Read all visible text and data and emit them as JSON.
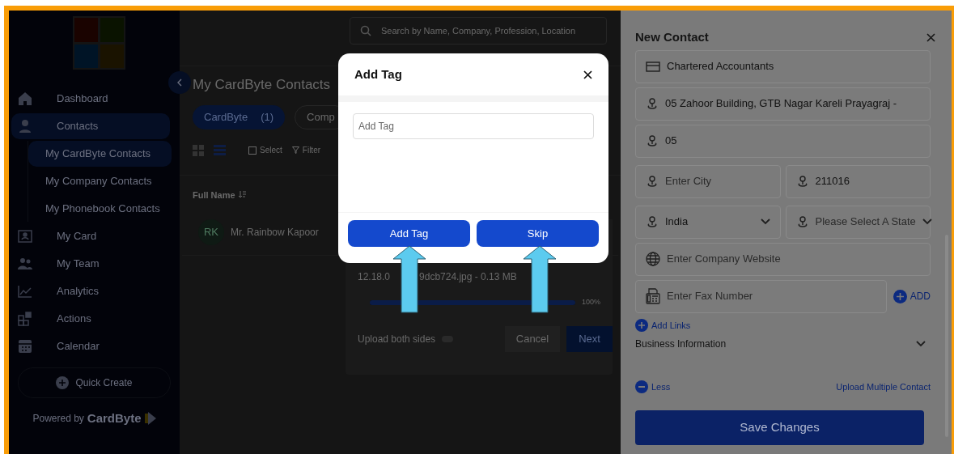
{
  "sidebar": {
    "items": [
      {
        "label": "Dashboard",
        "selected": false
      },
      {
        "label": "Contacts",
        "selected": true,
        "children": [
          {
            "label": "My CardByte Contacts",
            "selected": true
          },
          {
            "label": "My Company Contacts",
            "selected": false
          },
          {
            "label": "My Phonebook Contacts",
            "selected": false
          }
        ]
      },
      {
        "label": "My Card",
        "selected": false
      },
      {
        "label": "My Team",
        "selected": false
      },
      {
        "label": "Analytics",
        "selected": false
      },
      {
        "label": "Actions",
        "selected": false
      },
      {
        "label": "Calendar",
        "selected": false
      }
    ],
    "quick_create": "Quick Create",
    "powered_by": "Powered by",
    "brand": "CardByte"
  },
  "main": {
    "search": {
      "placeholder": "Search by Name, Company, Profession, Location"
    },
    "title": "My CardByte Contacts",
    "tabs": [
      {
        "label": "CardByte",
        "count": "(1)",
        "selected": true
      },
      {
        "label": "Comp",
        "selected": false
      }
    ],
    "toolbar": {
      "select": {
        "label": "Select",
        "checked": false
      },
      "filter": "Filter"
    },
    "table": {
      "columns": [
        "Full Name"
      ],
      "rows": [
        {
          "initials": "RK",
          "name": "Mr. Rainbow Kapoor"
        }
      ]
    },
    "upload": {
      "file_start": "12.18.0",
      "file_end": "9dcb724.jpg - 0.13 MB",
      "level": 1,
      "percent": "100%",
      "both_sides": {
        "label": "Upload both sides",
        "on": false
      },
      "buttons": [
        "Cancel",
        "Next"
      ]
    }
  },
  "panel": {
    "title": "New Contact",
    "fields": [
      {
        "kind": "text",
        "value": "Chartered Accountants"
      },
      {
        "kind": "text",
        "value": "05 Zahoor Building, GTB Nagar Kareli Prayagraj -"
      },
      {
        "kind": "text",
        "value": "05"
      },
      {
        "kind": "pair",
        "items": [
          {
            "kind": "text",
            "placeholder": "Enter City"
          },
          {
            "kind": "text",
            "value": "211016"
          }
        ]
      },
      {
        "kind": "pair",
        "items": [
          {
            "kind": "select",
            "value": "India"
          },
          {
            "kind": "select",
            "placeholder": "Please Select A State"
          }
        ]
      },
      {
        "kind": "text",
        "placeholder": "Enter Company Website"
      },
      {
        "kind": "add",
        "placeholder": "Enter Fax Number",
        "add": "ADD"
      }
    ],
    "add_links": "Add Links",
    "section": {
      "label": "Business Information",
      "expanded": false
    },
    "less": "Less",
    "upload_multiple": "Upload Multiple Contact",
    "save": "Save Changes"
  },
  "dialog": {
    "title": "Add Tag",
    "input": {
      "placeholder": "Add Tag"
    },
    "buttons": [
      "Add Tag",
      "Skip"
    ]
  }
}
